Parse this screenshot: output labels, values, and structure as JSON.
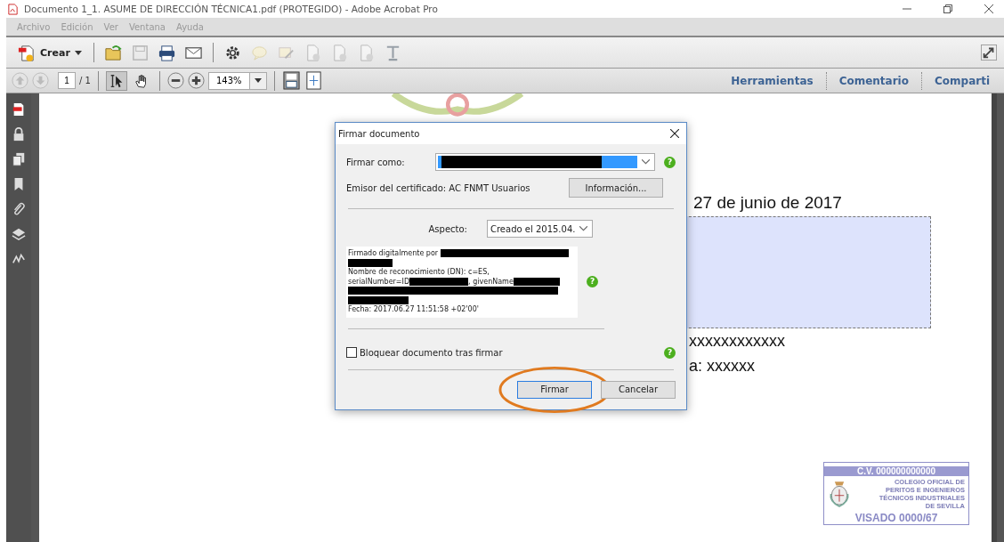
{
  "window": {
    "title": "Documento 1_1. ASUME DE DIRECCIÓN TÉCNICA1.pdf (PROTEGIDO) - Adobe Acrobat Pro"
  },
  "menu": [
    {
      "label": "Archivo",
      "disabled": true
    },
    {
      "label": "Edición",
      "disabled": true
    },
    {
      "label": "Ver",
      "disabled": true
    },
    {
      "label": "Ventana",
      "disabled": true
    },
    {
      "label": "Ayuda",
      "disabled": true
    }
  ],
  "toolbar": {
    "create_label": "Crear",
    "tools": [
      {
        "kind": "open",
        "disabled": false
      },
      {
        "kind": "save",
        "disabled": true
      },
      {
        "kind": "print",
        "disabled": false
      },
      {
        "kind": "email",
        "disabled": false
      },
      {
        "kind": "settings",
        "disabled": false
      },
      {
        "kind": "comment",
        "disabled": true
      },
      {
        "kind": "edit",
        "disabled": true
      },
      {
        "kind": "doc",
        "disabled": true
      },
      {
        "kind": "doc",
        "disabled": true
      },
      {
        "kind": "doc",
        "disabled": true
      },
      {
        "kind": "text",
        "disabled": true
      }
    ]
  },
  "navigation": {
    "page": "1",
    "total": "/ 1",
    "zoom": "143%",
    "tools": [
      {
        "kind": "select",
        "selected": true
      },
      {
        "kind": "hand",
        "selected": false
      }
    ]
  },
  "panel_tabs": [
    {
      "label": "Herramientas"
    },
    {
      "label": "Comentario"
    },
    {
      "label": "Comparti"
    }
  ],
  "sidebar": [
    {
      "kind": "pdf"
    },
    {
      "kind": "lock"
    },
    {
      "kind": "pages"
    },
    {
      "kind": "bookmark"
    },
    {
      "kind": "attachment"
    },
    {
      "kind": "layers"
    },
    {
      "kind": "signature"
    }
  ],
  "document": {
    "date": "27 de junio de 2017",
    "line_1": "xxxxxxxxxxxx",
    "line_2": "a: xxxxxx",
    "stamp": {
      "number": "C.V. 000000000000",
      "lines": [
        "COLEGIO OFICIAL DE",
        "PERITOS E INGENIEROS",
        "TÉCNICOS INDUSTRIALES",
        "DE SEVILLA"
      ],
      "visa": "VISADO 0000/67"
    }
  },
  "dialog": {
    "help_marks": [
      "?",
      "?",
      "?"
    ],
    "title": "Firmar documento",
    "sign_as_label": "Firmar como:",
    "issuer": "Emisor del certificado: AC FNMT Usuarios",
    "info_button": "Información...",
    "appearance_label": "Aspecto:",
    "appearance_value": "Creado el 2015.04.",
    "preview": {
      "signed_by": "Firmado digitalmente por",
      "dn": "Nombre de reconocimiento (DN): c=ES,",
      "serial": "serialNumber=ID",
      "given": ", givenName",
      "date": "Fecha: 2017.06.27 11:51:58 +02'00'"
    },
    "lock": {
      "label": "Bloquear documento tras firmar",
      "checked": false
    },
    "buttons": [
      {
        "label": "Firmar",
        "default": true,
        "highlighted": true
      },
      {
        "label": "Cancelar",
        "default": false,
        "highlighted": false
      }
    ]
  }
}
